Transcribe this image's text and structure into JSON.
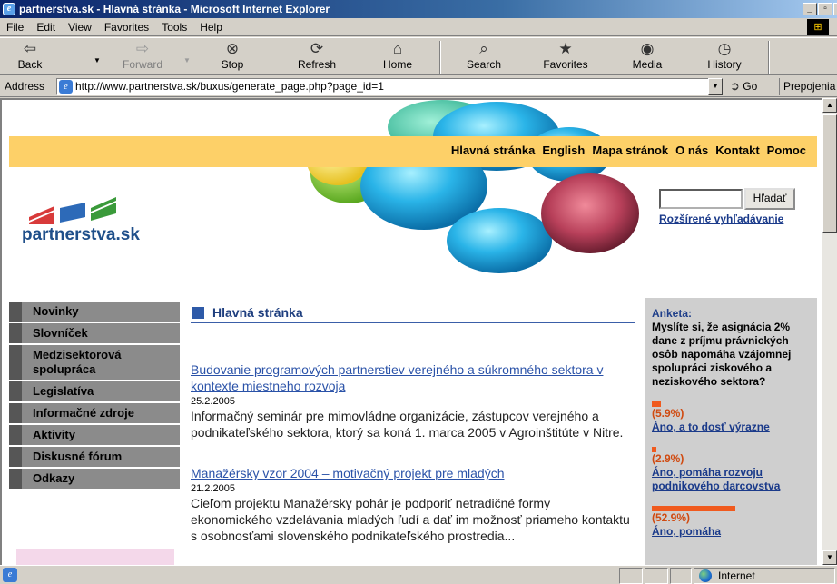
{
  "window": {
    "title": "partnerstva.sk - Hlavná stránka - Microsoft Internet Explorer"
  },
  "menu": [
    "File",
    "Edit",
    "View",
    "Favorites",
    "Tools",
    "Help"
  ],
  "toolbar": {
    "back": "Back",
    "forward": "Forward",
    "stop": "Stop",
    "refresh": "Refresh",
    "home": "Home",
    "search": "Search",
    "favorites": "Favorites",
    "media": "Media",
    "history": "History"
  },
  "address": {
    "label": "Address",
    "url": "http://www.partnerstva.sk/buxus/generate_page.php?page_id=1",
    "go": "Go",
    "links": "Prepojenia"
  },
  "status": {
    "zone": "Internet"
  },
  "site": {
    "logo_text": "partnerstva.sk",
    "topnav": [
      "Hlavná stránka",
      "English",
      "Mapa stránok",
      "O nás",
      "Kontakt",
      "Pomoc"
    ],
    "search_button": "Hľadať",
    "advanced_search": "Rozšírené vyhľadávanie",
    "sidebar": [
      "Novinky",
      "Slovníček",
      "Medzisektorová spolupráca",
      "Legislatíva",
      "Informačné zdroje",
      "Aktivity",
      "Diskusné fórum",
      "Odkazy"
    ],
    "section_title": "Hlavná stránka",
    "articles": [
      {
        "title": "Budovanie programových partnerstiev verejného a súkromného sektora v kontexte miestneho rozvoja",
        "date": "25.2.2005",
        "text": "Informačný seminár pre mimovládne organizácie, zástupcov verejného a podnikateľského sektora, ktorý sa koná 1. marca 2005 v Agroinštitúte v Nitre."
      },
      {
        "title": "Manažérsky vzor 2004 – motivačný projekt pre mladých",
        "date": "21.2.2005",
        "text": "Cieľom projektu Manažérsky pohár je podporiť netradičné formy ekonomického vzdelávania mladých ľudí a dať im možnosť priameho kontaktu s osobnosťami slovenského podnikateľského prostredia..."
      }
    ],
    "poll": {
      "heading": "Anketa:",
      "question": "Myslíte si, že asignácia 2% dane z príjmu právnických osôb napomáha vzájomnej spolupráci ziskového a neziskového sektora?",
      "options": [
        {
          "percent": "(5.9%)",
          "value": 5.9,
          "label": "Áno, a to dosť výrazne"
        },
        {
          "percent": "(2.9%)",
          "value": 2.9,
          "label": "Áno, pomáha rozvoju podnikového darcovstva"
        },
        {
          "percent": "(52.9%)",
          "value": 52.9,
          "label": "Áno, pomáha"
        }
      ]
    },
    "colors": {
      "nav_bar": "#fdd068",
      "sidebar_item": "#8b8b8b",
      "link": "#2a52a8",
      "poll_bar": "#f05a1e"
    }
  }
}
